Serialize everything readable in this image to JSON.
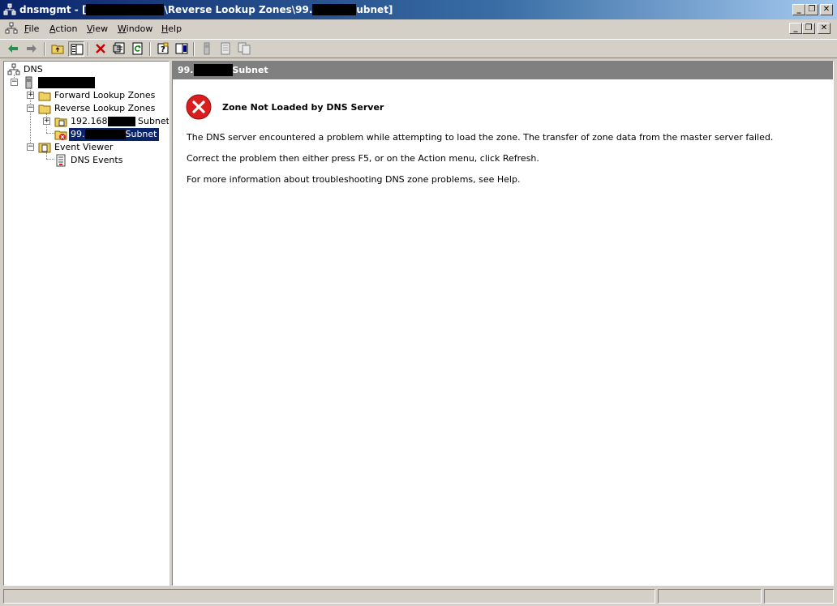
{
  "window": {
    "title_prefix": "dnsmgmt - [",
    "title_middle": "\\Reverse Lookup Zones\\99.",
    "title_suffix": "ubnet]"
  },
  "menu": {
    "items": [
      {
        "hotkey": "F",
        "rest": "ile"
      },
      {
        "hotkey": "A",
        "rest": "ction"
      },
      {
        "hotkey": "V",
        "rest": "iew"
      },
      {
        "hotkey": "W",
        "rest": "indow"
      },
      {
        "hotkey": "H",
        "rest": "elp"
      }
    ]
  },
  "tree": {
    "root": "DNS",
    "forward": "Forward Lookup Zones",
    "reverse": "Reverse Lookup Zones",
    "zone1_prefix": "192.168",
    "zone1_suffix": "Subnet",
    "zone2_prefix": "99.",
    "zone2_suffix": "Subnet",
    "event_viewer": "Event Viewer",
    "dns_events": "DNS Events"
  },
  "content": {
    "header_prefix": "99.",
    "header_suffix": "Subnet",
    "error_title": "Zone Not Loaded by DNS Server",
    "messages": [
      "The DNS server encountered a problem while attempting to load the zone. The transfer of zone data from the master server failed.",
      "Correct the problem then either press F5, or on the Action menu, click Refresh.",
      "For more information about troubleshooting DNS zone problems, see Help."
    ]
  },
  "colors": {
    "title_active": "#0a246a",
    "selection": "#0a246a",
    "error_red": "#d81e1e",
    "face": "#d4d0c8"
  }
}
